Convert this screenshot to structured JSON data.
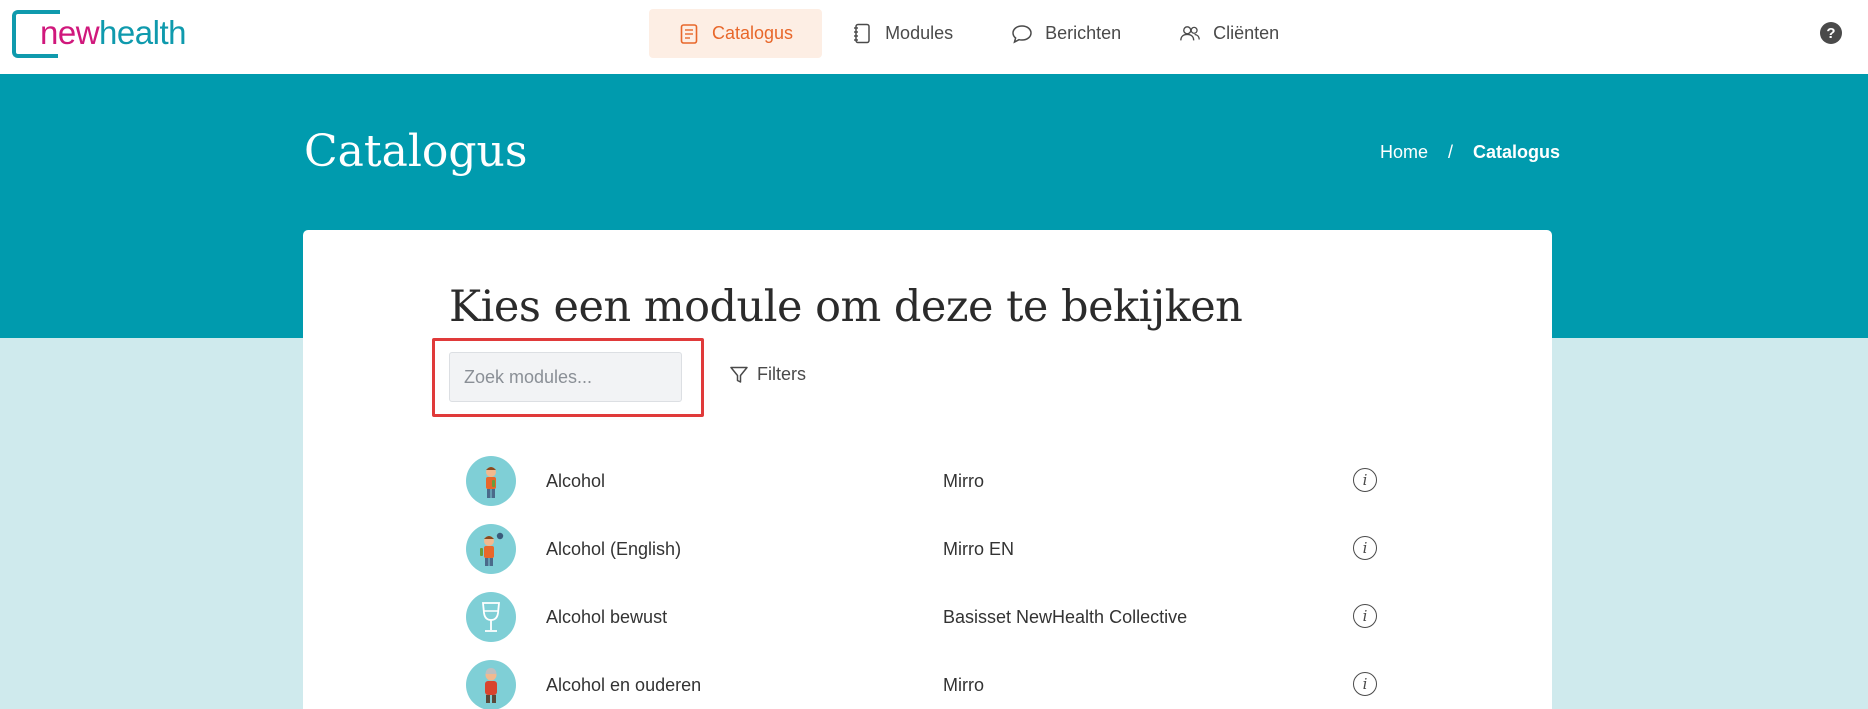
{
  "app": {
    "logo_part1": "new",
    "logo_part2": "health"
  },
  "nav": {
    "items": [
      {
        "label": "Catalogus",
        "icon": "catalog-icon",
        "active": true
      },
      {
        "label": "Modules",
        "icon": "notebook-icon",
        "active": false
      },
      {
        "label": "Berichten",
        "icon": "chat-bubble-icon",
        "active": false
      },
      {
        "label": "Cliënten",
        "icon": "users-icon",
        "active": false
      }
    ],
    "help_label": "?"
  },
  "header": {
    "title": "Catalogus",
    "breadcrumb": {
      "home": "Home",
      "separator": "/",
      "current": "Catalogus"
    }
  },
  "main": {
    "heading": "Kies een module om deze te bekijken",
    "search": {
      "placeholder": "Zoek modules...",
      "value": ""
    },
    "filters_label": "Filters",
    "modules": [
      {
        "name": "Alcohol",
        "set": "Mirro",
        "icon": "person-bottle-icon"
      },
      {
        "name": "Alcohol (English)",
        "set": "Mirro EN",
        "icon": "person-bottle-icon"
      },
      {
        "name": "Alcohol bewust",
        "set": "Basisset NewHealth Collective",
        "icon": "wine-glass-icon"
      },
      {
        "name": "Alcohol en ouderen",
        "set": "Mirro",
        "icon": "elderly-person-icon"
      }
    ],
    "info_label": "i"
  },
  "colors": {
    "brand_teal": "#009bae",
    "brand_pink": "#d0187c",
    "active_nav_bg": "#fdeee4",
    "active_nav_text": "#e8672a",
    "highlight_border": "#e03a3a",
    "page_bg": "#cfeaed"
  }
}
